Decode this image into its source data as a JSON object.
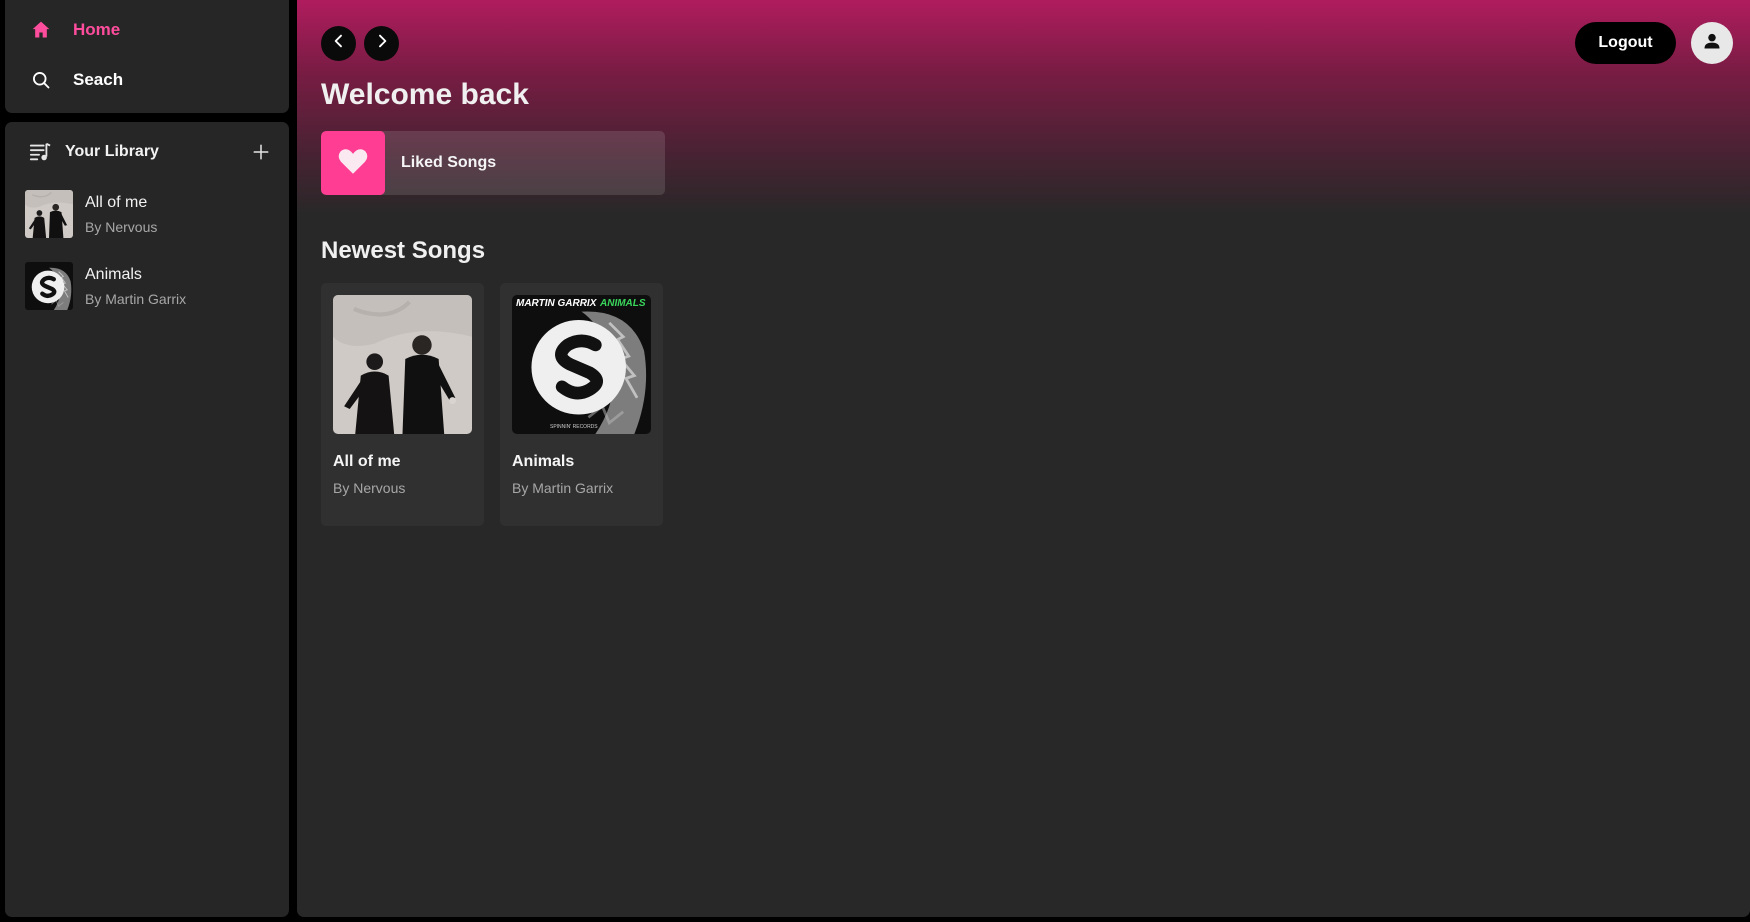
{
  "sidebar": {
    "nav": {
      "home_label": "Home",
      "search_label": "Seach"
    },
    "library": {
      "title": "Your Library",
      "items": [
        {
          "title": "All of me",
          "artist": "By Nervous"
        },
        {
          "title": "Animals",
          "artist": "By Martin Garrix"
        }
      ]
    }
  },
  "header": {
    "logout_label": "Logout"
  },
  "main": {
    "welcome": "Welcome back",
    "liked_songs_label": "Liked Songs",
    "newest_title": "Newest Songs",
    "songs": [
      {
        "title": "All of me",
        "artist": "By Nervous"
      },
      {
        "title": "Animals",
        "artist": "By Martin Garrix"
      }
    ],
    "animals_cover": {
      "artist_text": "MARTIN GARRIX",
      "title_text": "ANIMALS",
      "label_text": "SPINNIN' RECORDS"
    }
  },
  "colors": {
    "accent": "#ff4d9d",
    "liked_tile": "#ff3e93",
    "gradient_top": "#b01c5e",
    "panel": "#262626",
    "main_bg": "#282828"
  },
  "icons": {
    "home": "home-icon",
    "search": "search-icon",
    "library": "library-icon",
    "add": "plus-icon",
    "back": "chevron-left-icon",
    "forward": "chevron-right-icon",
    "user": "user-icon",
    "heart": "heart-icon"
  }
}
